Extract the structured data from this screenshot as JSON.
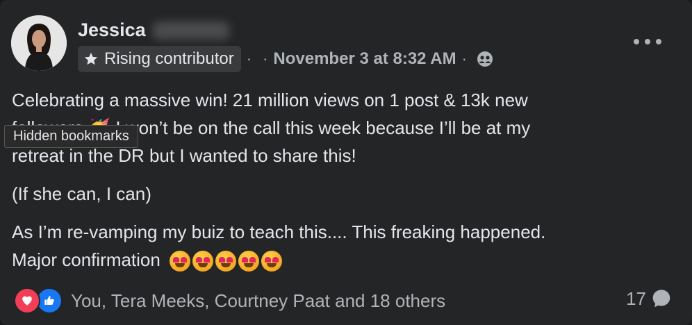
{
  "author": {
    "first_name": "Jessica",
    "badge_label": "Rising contributor"
  },
  "meta": {
    "separator": "·",
    "timestamp": "November 3 at 8:32 AM",
    "audience_icon": "group-icon"
  },
  "post": {
    "paragraph1_a": "Celebrating a massive win! 21 million views on 1 post & 13k new",
    "paragraph1_b": "followers 🥳 I won’t be on the call this week because I’ll be at my",
    "paragraph1_c": "retreat in the DR but I wanted to share this!",
    "paragraph2": "(If she can, I can)",
    "paragraph3_a": "As I’m re-vamping my buiz to teach this.... This freaking happened.",
    "paragraph3_b": "Major confirmation",
    "emoji_count": 5
  },
  "tooltip": "Hidden bookmarks",
  "reactions": {
    "names": "You, Tera Meeks, Courtney Paat and 18 others",
    "icons": [
      "love-icon",
      "like-icon"
    ]
  },
  "comments": {
    "count": "17"
  },
  "colors": {
    "background": "#242526",
    "text": "#e4e6eb",
    "secondary": "#b0b3b8",
    "love": "#f33e58",
    "like": "#1877f2"
  }
}
